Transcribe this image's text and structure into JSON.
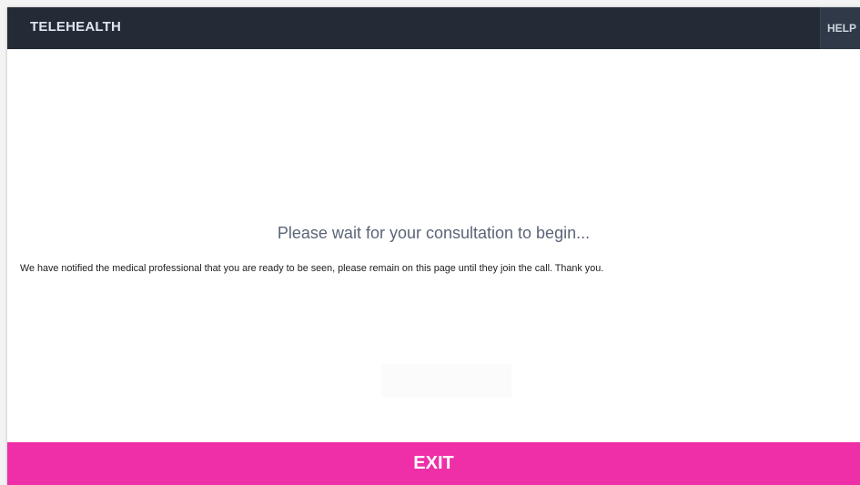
{
  "header": {
    "app_title": "TELEHEALTH",
    "help_label": "HELP"
  },
  "main": {
    "heading": "Please wait for your consultation to begin...",
    "message": "We have notified the medical professional that you are ready to be seen, please remain on this page until they join the call. Thank you."
  },
  "footer": {
    "exit_label": "EXIT"
  },
  "colors": {
    "header_bg": "#242b37",
    "exit_bg": "#ee2fa8",
    "heading_text": "#5b6577"
  }
}
